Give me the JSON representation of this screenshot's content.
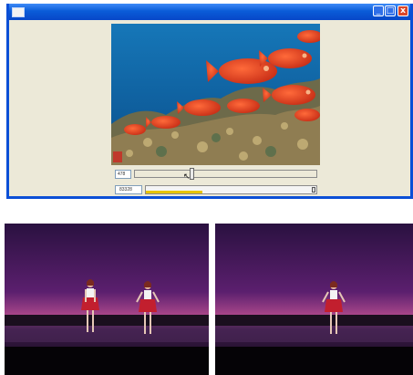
{
  "window": {
    "title": "",
    "buttons": {
      "minimize": "_",
      "maximize": "□",
      "close": "x"
    }
  },
  "video": {
    "description_icon": "video-frame"
  },
  "controls": {
    "frame_number": "478",
    "time_value": "83328",
    "seek_position": 0.31,
    "progress": 0.33,
    "cursor_icon": "pointer-cursor-icon"
  },
  "photos": [
    {
      "name": "stage-two-dancers"
    },
    {
      "name": "stage-one-dancer"
    }
  ],
  "colors": {
    "titlebar": "#0a5cd8",
    "window_bg": "#ece9d8",
    "progress_fill": "#e8c400",
    "stage_purple": "#5b1f6e"
  }
}
